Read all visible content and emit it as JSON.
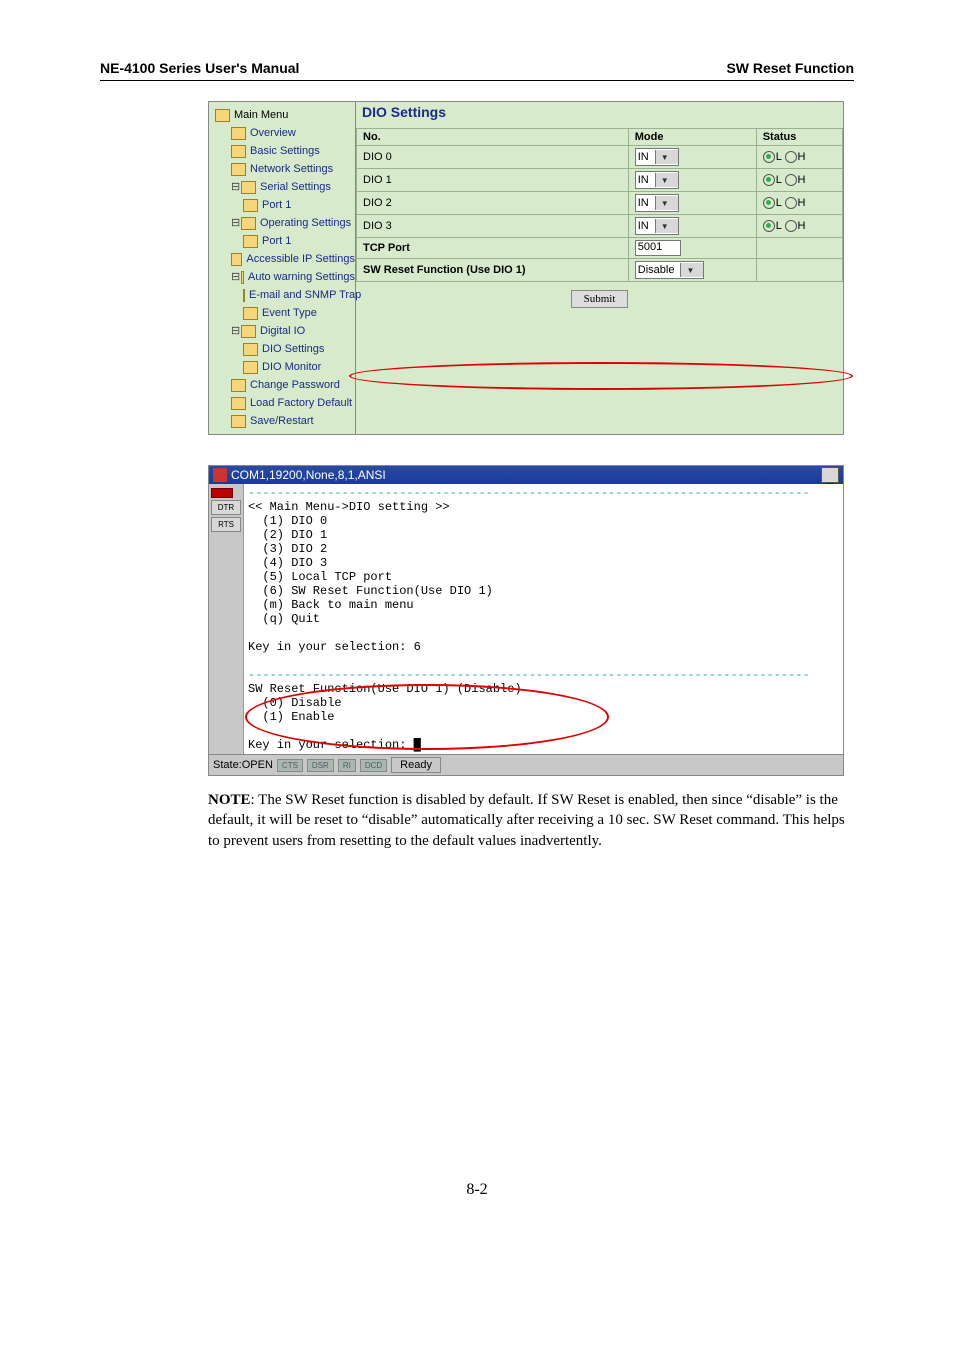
{
  "header": {
    "left": "NE-4100 Series User's Manual",
    "right": "SW Reset Function"
  },
  "tree": {
    "root": "Main Menu",
    "items": [
      "Overview",
      "Basic Settings",
      "Network Settings",
      "Serial Settings",
      "Port 1",
      "Operating Settings",
      "Port 1",
      "Accessible IP Settings",
      "Auto warning Settings",
      "E-mail and SNMP Trap",
      "Event Type",
      "Digital IO",
      "DIO Settings",
      "DIO Monitor",
      "Change Password",
      "Load Factory Default",
      "Save/Restart"
    ]
  },
  "pane": {
    "title": "DIO Settings",
    "headers": {
      "no": "No.",
      "mode": "Mode",
      "status": "Status"
    },
    "rows": [
      {
        "no": "DIO 0",
        "mode": "IN",
        "statusL": "L",
        "statusH": "H",
        "sel": "L"
      },
      {
        "no": "DIO 1",
        "mode": "IN",
        "statusL": "L",
        "statusH": "H",
        "sel": "L"
      },
      {
        "no": "DIO 2",
        "mode": "IN",
        "statusL": "L",
        "statusH": "H",
        "sel": "L"
      },
      {
        "no": "DIO 3",
        "mode": "IN",
        "statusL": "L",
        "statusH": "H",
        "sel": "L"
      }
    ],
    "tcp_label": "TCP Port",
    "tcp_value": "5001",
    "sw_label": "SW Reset Function (Use DIO 1)",
    "sw_value": "Disable",
    "submit": "Submit"
  },
  "terminal": {
    "title": "COM1,19200,None,8,1,ANSI",
    "side": {
      "dtr": "DTR",
      "rts": "RTS"
    },
    "dash1": "------------------------------------------------------------------------------",
    "menu_head": "<< Main Menu->DIO setting >>",
    "menu": [
      "  (1) DIO 0",
      "  (2) DIO 1",
      "  (3) DIO 2",
      "  (4) DIO 3",
      "  (5) Local TCP port",
      "  (6) SW Reset Function(Use DIO 1)",
      "  (m) Back to main menu",
      "  (q) Quit"
    ],
    "prompt1": "Key in your selection: 6",
    "dash2": "------------------------------------------------------------------------------",
    "sw_head": "SW Reset Function(Use DIO 1) (Disable)",
    "sw_opts": [
      "  (0) Disable",
      "  (1) Enable"
    ],
    "prompt2": "Key in your selection: ",
    "status": {
      "state": "State:OPEN",
      "leds": [
        "CTS",
        "DSR",
        "RI",
        "DCD"
      ],
      "ready": "Ready"
    }
  },
  "note": {
    "label": "NOTE",
    "body": ": The SW Reset function is disabled by default. If SW Reset is enabled, then since “disable” is the default, it will be reset to “disable” automatically after receiving a 10 sec. SW Reset command. This helps to prevent users from resetting to the default values inadvertently."
  },
  "page_number": "8-2"
}
